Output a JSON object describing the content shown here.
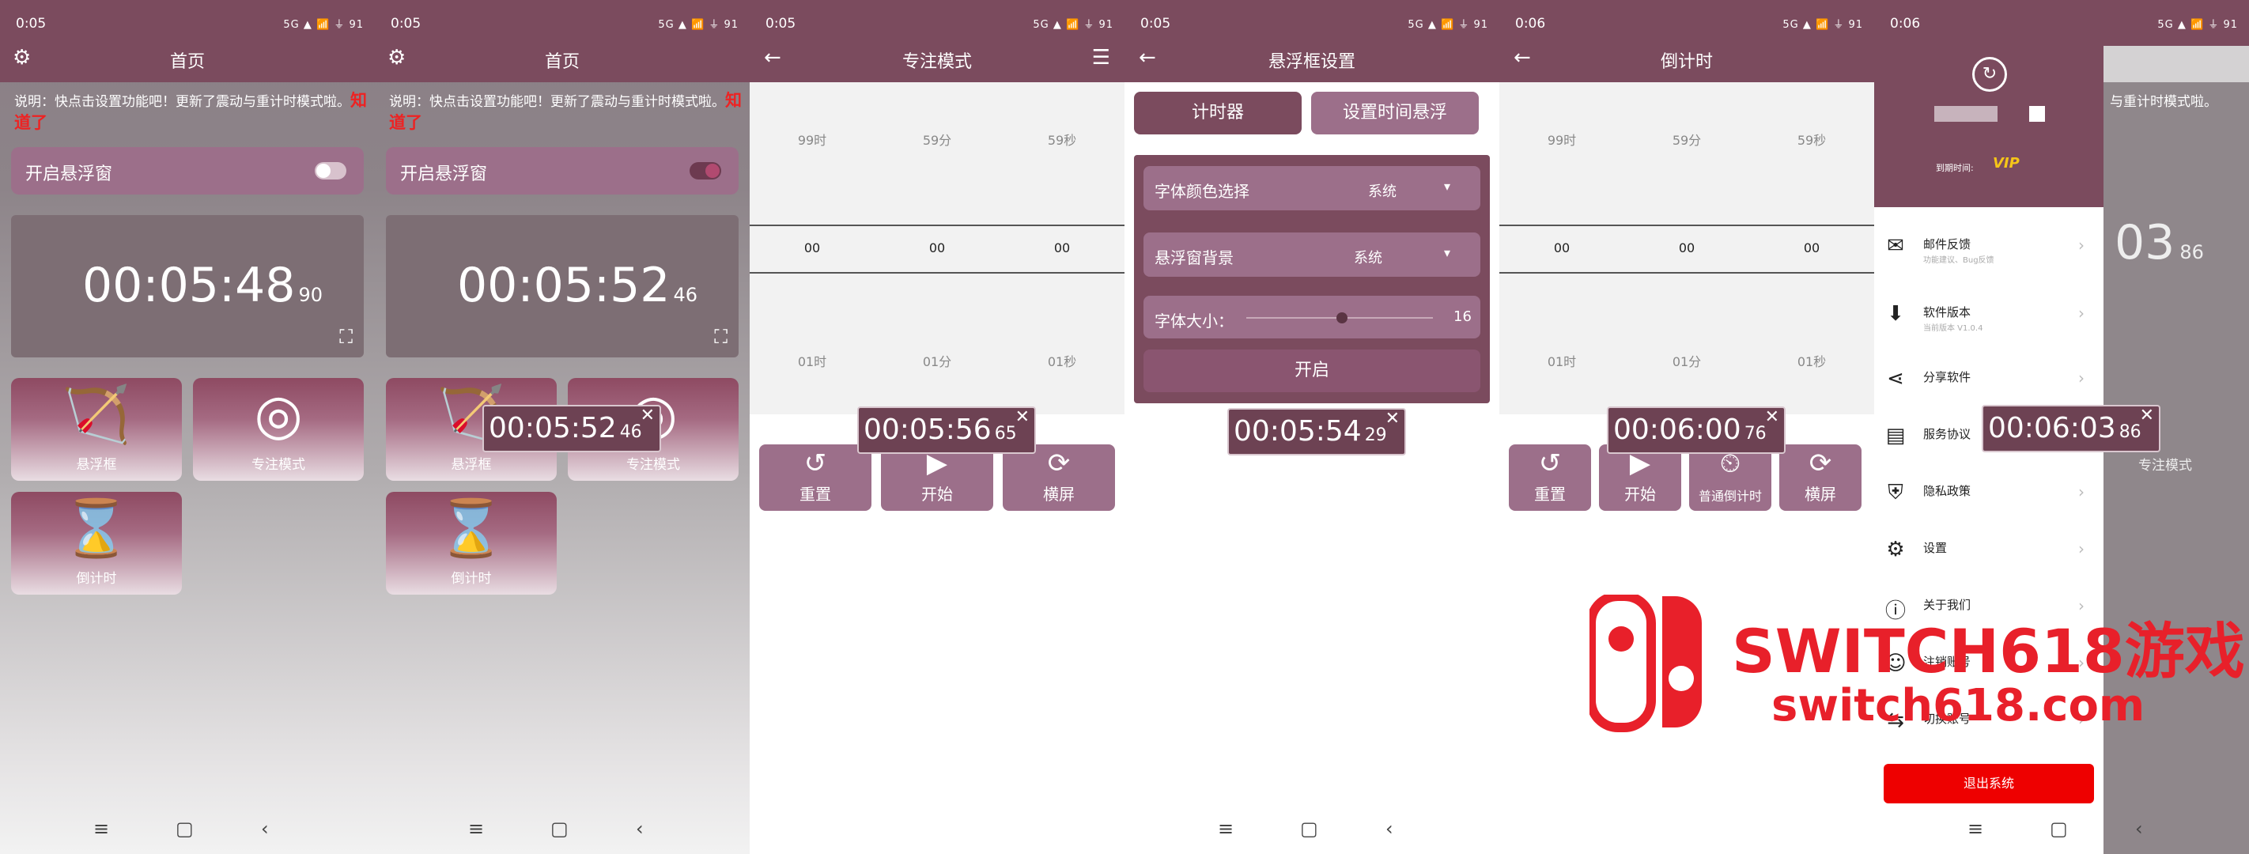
{
  "status_times": [
    "0:05",
    "0:05",
    "0:05",
    "0:05",
    "0:06",
    "0:06"
  ],
  "status_right": "5G ▲ 📶 ⏚ 91",
  "colors": {
    "primary": "#7b4b5e",
    "tile": "#9c6f8a",
    "danger": "#ee0000",
    "notice_red": "#e22222"
  },
  "home": {
    "title": "首页",
    "notice_text": "说明：快点击设置功能吧！更新了震动与重计时模式啦。",
    "notice_link": "知道了",
    "float_toggle_label": "开启悬浮窗",
    "tiles": [
      "悬浮框",
      "专注模式",
      "倒计时"
    ]
  },
  "screen1": {
    "clock": "00:05:48",
    "ms": "90",
    "toggle_on": false
  },
  "screen2": {
    "clock": "00:05:52",
    "ms": "46",
    "toggle_on": true,
    "overlay_time": "00:05:52",
    "overlay_ms": "46"
  },
  "screen3": {
    "title": "专注模式",
    "picker_top": [
      "99时",
      "59分",
      "59秒"
    ],
    "picker_selected": [
      "00",
      "00",
      "00"
    ],
    "picker_bottom": [
      "01时",
      "01分",
      "01秒"
    ],
    "buttons": [
      "重置",
      "开始",
      "横屏"
    ],
    "overlay_time": "00:05:56",
    "overlay_ms": "65"
  },
  "screen4": {
    "title": "悬浮框设置",
    "tab_active": "计时器",
    "tab_other": "设置时间悬浮",
    "font_color_label": "字体颜色选择",
    "font_color_value": "系统",
    "bg_label": "悬浮窗背景",
    "bg_value": "系统",
    "font_size_label": "字体大小：",
    "font_size_value": "16",
    "start_label": "开启",
    "overlay_time": "00:05:54",
    "overlay_ms": "29"
  },
  "screen5": {
    "title": "倒计时",
    "picker_top": [
      "99时",
      "59分",
      "59秒"
    ],
    "picker_selected": [
      "00",
      "00",
      "00"
    ],
    "picker_bottom": [
      "01时",
      "01分",
      "01秒"
    ],
    "buttons": [
      "重置",
      "开始",
      "普通倒计时",
      "横屏"
    ],
    "overlay_time": "00:06:00",
    "overlay_ms": "76"
  },
  "screen6": {
    "expiry_label": "到期时间:",
    "vip": "VIP",
    "menu": [
      {
        "title": "邮件反馈",
        "sub": "功能建议、Bug反馈"
      },
      {
        "title": "软件版本",
        "sub": "当前版本 V1.0.4"
      },
      {
        "title": "分享软件",
        "sub": ""
      },
      {
        "title": "服务协议",
        "sub": ""
      },
      {
        "title": "隐私政策",
        "sub": ""
      },
      {
        "title": "设置",
        "sub": ""
      },
      {
        "title": "关于我们",
        "sub": ""
      },
      {
        "title": "注销账号",
        "sub": ""
      },
      {
        "title": "切换账号",
        "sub": ""
      }
    ],
    "logout": "退出系统",
    "bg_notice_text": "与重计时模式啦。",
    "bg_clock_partial": "03",
    "bg_clock_ms": "86",
    "bg_tile_label": "专注模式",
    "overlay_time": "00:06:03",
    "overlay_ms": "86"
  },
  "watermark": {
    "line1": "SWITCH618游戏",
    "line2": "switch618.com"
  }
}
